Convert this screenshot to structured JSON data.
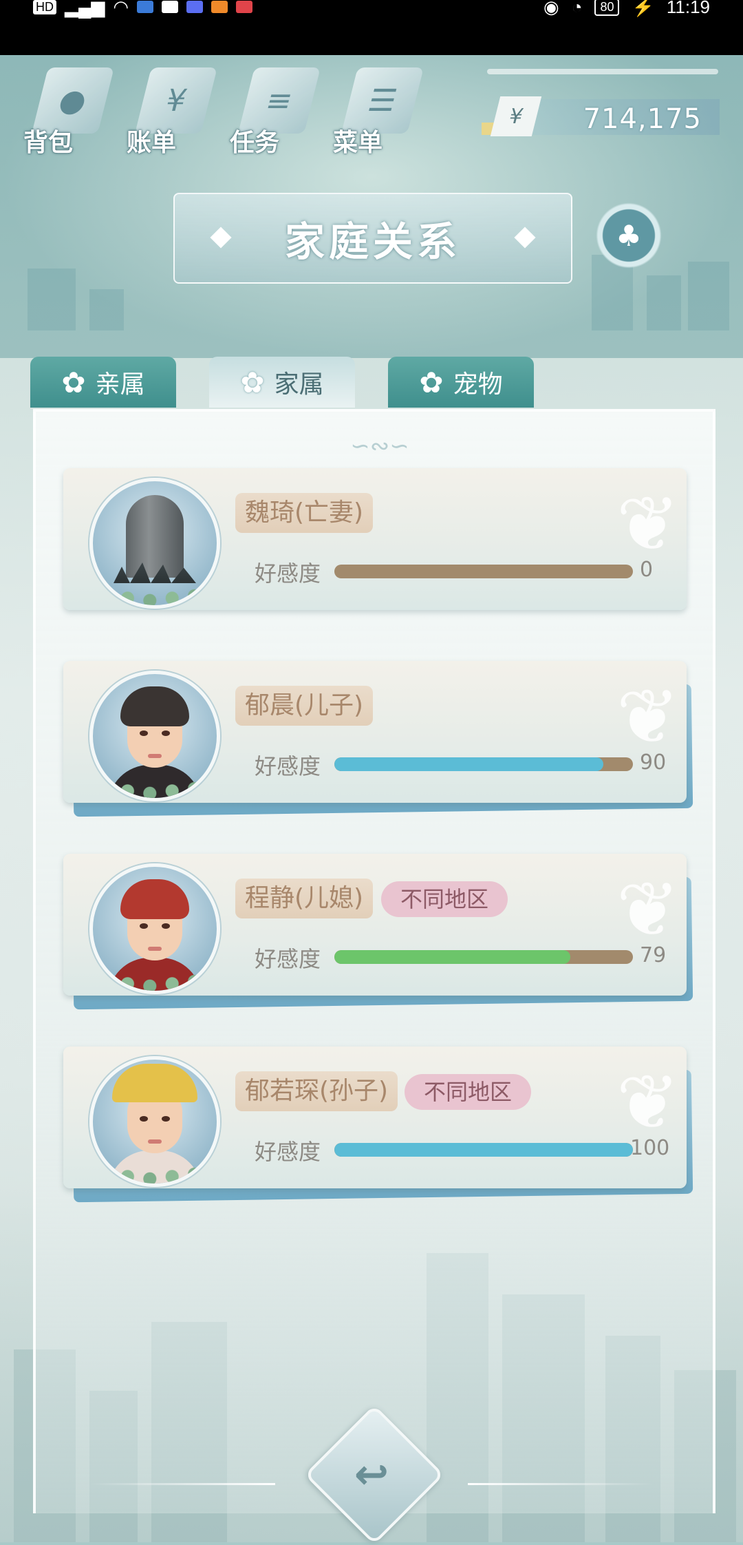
{
  "status_bar": {
    "left_chip": "HD",
    "battery": "80",
    "time": "11:19"
  },
  "nav": {
    "items": [
      {
        "label": "背包",
        "icon": "bag-icon"
      },
      {
        "label": "账单",
        "icon": "bill-icon"
      },
      {
        "label": "任务",
        "icon": "task-icon"
      },
      {
        "label": "菜单",
        "icon": "menu-icon"
      }
    ]
  },
  "money": {
    "symbol": "¥",
    "value": "714,175"
  },
  "title": "家庭关系",
  "tabs": [
    {
      "label": "亲属",
      "active": false
    },
    {
      "label": "家属",
      "active": true
    },
    {
      "label": "宠物",
      "active": false
    }
  ],
  "affinity_label": "好感度",
  "members": [
    {
      "name": "魏琦(亡妻)",
      "region": "",
      "affinity": 0,
      "affinity_text": "0",
      "bar_color": "#a28a6c"
    },
    {
      "name": "郁晨(儿子)",
      "region": "",
      "affinity": 90,
      "affinity_text": "90",
      "bar_color": "#5bbcd6"
    },
    {
      "name": "程静(儿媳)",
      "region": "不同地区",
      "affinity": 79,
      "affinity_text": "79",
      "bar_color": "#6cc56a"
    },
    {
      "name": "郁若琛(孙子)",
      "region": "不同地区",
      "affinity": 100,
      "affinity_text": "100",
      "bar_color": "#5bbcd6"
    }
  ]
}
